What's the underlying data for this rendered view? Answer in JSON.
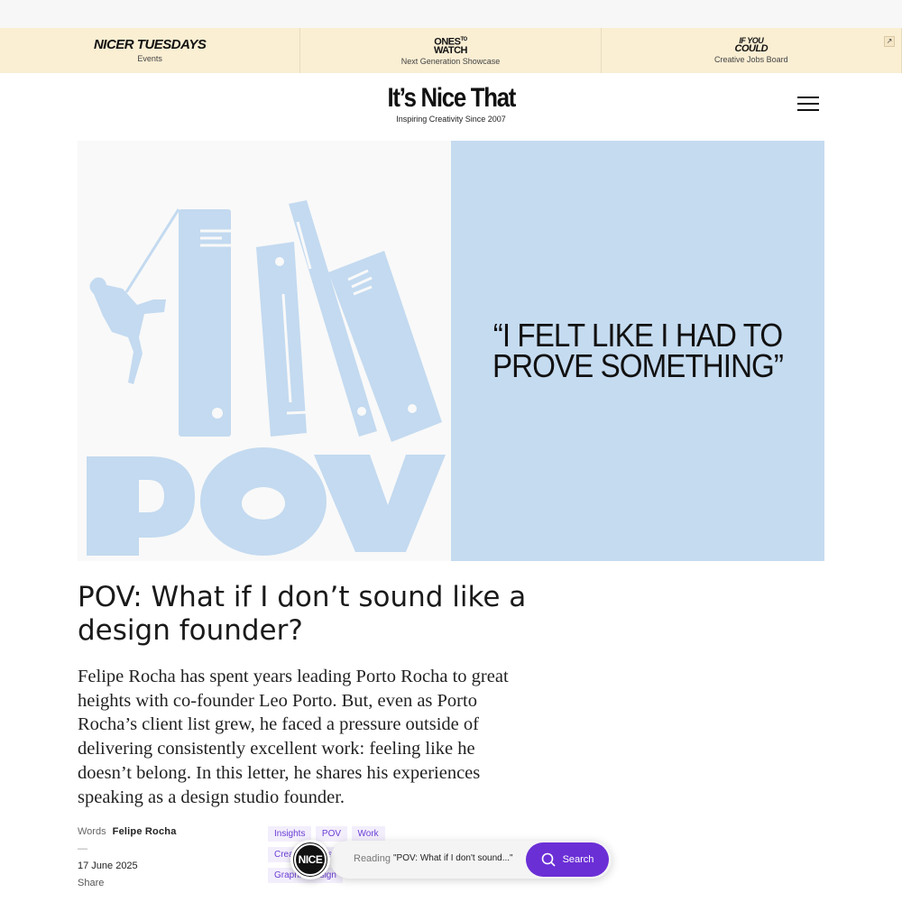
{
  "promo": {
    "items": [
      {
        "logo": "NICER TUESDAYS",
        "label": "Events"
      },
      {
        "logo_top": "ONES",
        "logo_mid": "TO",
        "logo_bottom": "WATCH",
        "label": "Next Generation Showcase"
      },
      {
        "logo_top": "IF YOU",
        "logo_bottom": "COULD",
        "label": "Creative Jobs Board"
      }
    ],
    "external_icon": "↗"
  },
  "header": {
    "logo": "It’s Nice That",
    "tagline": "Inspiring Creativity Since 2007"
  },
  "hero": {
    "quote": "“I FELT LIKE I HAD TO PROVE SOMETHING”",
    "illustration_text": "POV",
    "colors": {
      "accent_blue": "#c5dbf0",
      "illustration_blue": "#c3daf0"
    }
  },
  "article": {
    "title": "POV: What if I don’t sound like a design founder?",
    "standfirst": "Felipe Rocha has spent years leading Porto Rocha to great heights with co-founder Leo Porto. But, even as Porto Rocha’s client list grew, he faced a pressure outside of delivering consistently excellent work: feeling like he doesn’t belong. In this letter, he shares his experiences speaking as a design studio founder."
  },
  "meta": {
    "words_label": "Words",
    "author": "Felipe Rocha",
    "dash": "—",
    "date": "17 June 2025",
    "share": "Share"
  },
  "tags": [
    "Insights",
    "POV",
    "Work",
    "Creative Industry",
    "Graphic Design"
  ],
  "reading_bar": {
    "badge": "NICE",
    "label": "Reading",
    "title": "\"POV: What if I don't sound...\"",
    "search_label": "Search",
    "accent": "#6b2fd6"
  }
}
